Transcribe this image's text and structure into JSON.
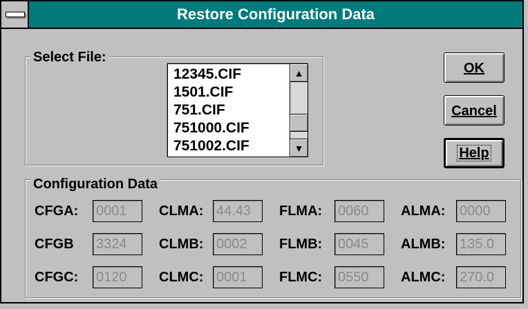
{
  "window": {
    "title": "Restore Configuration Data"
  },
  "select_file": {
    "legend": "Select File:",
    "files": [
      "12345.CIF",
      "1501.CIF",
      "751.CIF",
      "751000.CIF",
      "751002.CIF"
    ]
  },
  "buttons": {
    "ok": "OK",
    "cancel": "Cancel",
    "help": "Help"
  },
  "config": {
    "legend": "Configuration Data",
    "fields": [
      {
        "label": "CFGA:",
        "value": "0001"
      },
      {
        "label": "CLMA:",
        "value": "44.43"
      },
      {
        "label": "FLMA:",
        "value": "0060"
      },
      {
        "label": "ALMA:",
        "value": "0000"
      },
      {
        "label": "CFGB",
        "value": "3324"
      },
      {
        "label": "CLMB:",
        "value": "0002"
      },
      {
        "label": "FLMB:",
        "value": "0045"
      },
      {
        "label": "ALMB:",
        "value": "135.0"
      },
      {
        "label": "CFGC:",
        "value": "0120"
      },
      {
        "label": "CLMC:",
        "value": "0001"
      },
      {
        "label": "FLMC:",
        "value": "0550"
      },
      {
        "label": "ALMC:",
        "value": "270.0"
      }
    ]
  },
  "icons": {
    "system_menu": "system-menu-icon",
    "scroll_up": "arrow-up-icon",
    "scroll_down": "arrow-down-icon"
  }
}
